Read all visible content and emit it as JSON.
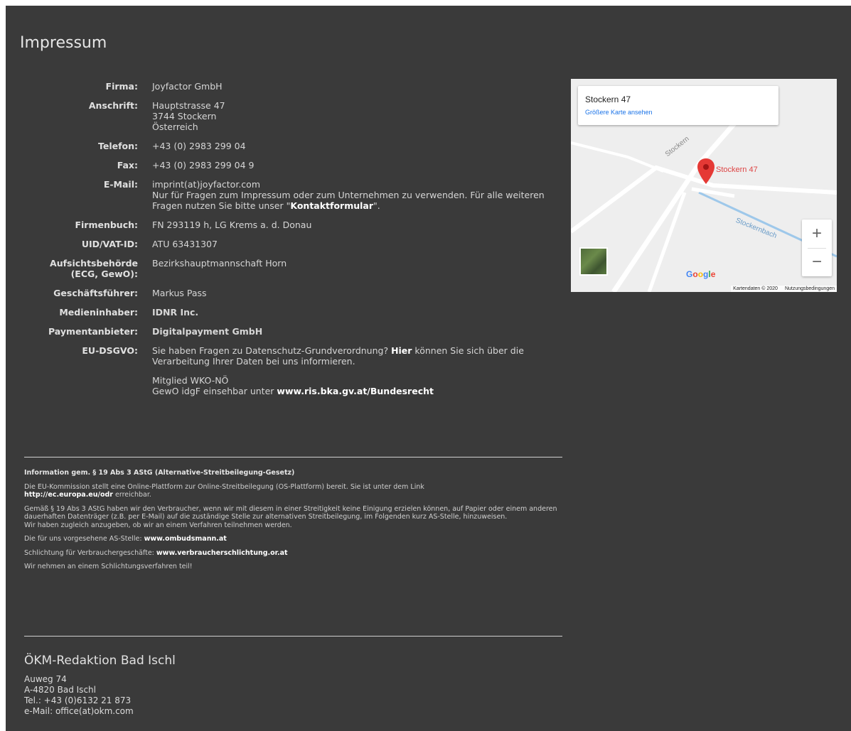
{
  "page": {
    "title": "Impressum"
  },
  "imprint": {
    "firma": {
      "label": "Firma:",
      "value": "Joyfactor GmbH"
    },
    "anschrift": {
      "label": "Anschrift:",
      "line1": "Hauptstrasse 47",
      "line2": "3744 Stockern",
      "line3": "Österreich"
    },
    "telefon": {
      "label": "Telefon:",
      "value": "+43 (0) 2983 299 04"
    },
    "fax": {
      "label": "Fax:",
      "value": "+43 (0) 2983 299 04 9"
    },
    "email": {
      "label": "E-Mail:",
      "value": "imprint(at)joyfactor.com",
      "note_before": "Nur für Fragen zum Impressum oder zum Unternehmen zu verwenden. Für alle weiteren Fragen nutzen Sie bitte unser \"",
      "note_link": "Kontaktformular",
      "note_after": "\"."
    },
    "firmenbuch": {
      "label": "Firmenbuch:",
      "value": "FN 293119 h, LG Krems a. d. Donau"
    },
    "uid": {
      "label": "UID/VAT-ID:",
      "value": "ATU 63431307"
    },
    "aufsicht": {
      "label_line1": "Aufsichtsbehörde",
      "label_line2": "(ECG, GewO):",
      "value": "Bezirkshauptmannschaft Horn"
    },
    "geschaeftsfuehrer": {
      "label": "Geschäftsführer:",
      "value": "Markus Pass"
    },
    "medieninhaber": {
      "label": "Medieninhaber:",
      "value": "IDNR Inc."
    },
    "payment": {
      "label": "Paymentanbieter:",
      "value": "Digitalpayment GmbH"
    },
    "dsgvo": {
      "label": "EU-DSGVO:",
      "text_before": "Sie haben Fragen zu Datenschutz-Grundverordnung? ",
      "link": "Hier",
      "text_after": " können Sie sich über die Verarbeitung Ihrer Daten bei uns informieren.",
      "wko_line": "Mitglied WKO-NÖ",
      "gewo_text": "GewO idgF einsehbar unter ",
      "gewo_link": "www.ris.bka.gv.at/Bundesrecht"
    }
  },
  "legal": {
    "heading": "Information gem. § 19 Abs 3 AStG (Alternative-Streitbeilegung-Gesetz)",
    "p1_text": "Die EU-Kommission stellt eine Online-Plattform zur Online-Streitbeilegung (OS-Plattform) bereit. Sie ist unter dem Link",
    "p1_link": "http://ec.europa.eu/odr",
    "p1_after": " erreichbar.",
    "p2": "Gemäß § 19 Abs 3 AStG haben wir den Verbraucher, wenn wir mit diesem in einer Streitigkeit keine Einigung erzielen können, auf Papier oder einem anderen dauerhaften Datenträger (z.B. per E-Mail) auf die zuständige Stelle zur alternativen Streitbeilegung, im Folgenden kurz AS-Stelle, hinzuweisen.",
    "p2b": "Wir haben zugleich anzugeben, ob wir an einem Verfahren teilnehmen werden.",
    "p3_text": "Die für uns vorgesehene AS-Stelle: ",
    "p3_link": "www.ombudsmann.at",
    "p4_text": "Schlichtung für Verbrauchergeschäfte: ",
    "p4_link": "www.verbraucherschlichtung.or.at",
    "p5": "Wir nehmen an einem Schlichtungsverfahren teil!"
  },
  "office": {
    "title": "ÖKM-Redaktion Bad Ischl",
    "line1": "Auweg 74",
    "line2": "A-4820 Bad Ischl",
    "line3": "Tel.: +43 (0)6132 21 873",
    "line4": "e-Mail: office(at)okm.com"
  },
  "map": {
    "place_name": "Stockern 47",
    "larger_map_link": "Größere Karte ansehen",
    "pin_label": "Stockern 47",
    "road_label_1": "Stockern",
    "road_label_2": "Stockernbach",
    "zoom_in": "+",
    "zoom_out": "−",
    "google_logo": [
      "G",
      "o",
      "o",
      "g",
      "l",
      "e"
    ],
    "attribution": "Kartendaten © 2020",
    "terms": "Nutzungsbedingungen"
  }
}
